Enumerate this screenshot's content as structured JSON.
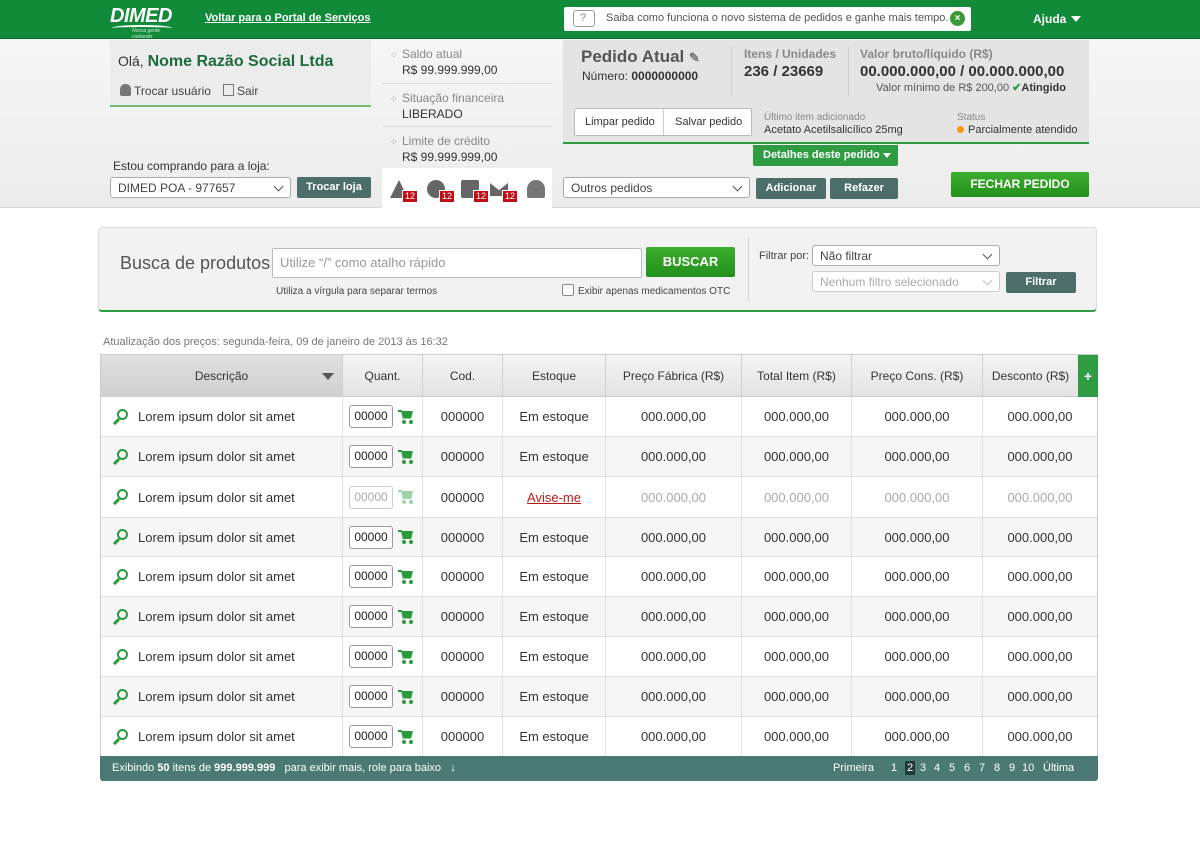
{
  "top": {
    "logo_text": "DIMED",
    "logo_tagline": "Nossa gente cuidando",
    "portal_link": "Voltar para o Portal de Serviços",
    "notice_text": "Saiba como funciona o novo sistema de pedidos e ganhe mais tempo.",
    "help_label": "Ajuda"
  },
  "user": {
    "greeting": "Olá,",
    "company_name": "Nome Razão Social Ltda",
    "switch_user": "Trocar usuário",
    "logout": "Sair",
    "store_label": "Estou comprando para a loja:",
    "store_value": "DIMED POA - 977657",
    "switch_store": "Trocar loja"
  },
  "finance": {
    "balance_label": "Saldo atual",
    "balance_value": "R$ 99.999.999,00",
    "status_label": "Situação financeira",
    "status_value": "LIBERADO",
    "limit_label": "Limite de crédito",
    "limit_value": "R$ 99.999.999,00",
    "alerts": [
      {
        "icon": "warning-icon",
        "count": "12"
      },
      {
        "icon": "dollar-icon",
        "count": "12"
      },
      {
        "icon": "calendar-icon",
        "count": "12"
      },
      {
        "icon": "mail-icon",
        "count": "12"
      }
    ]
  },
  "order": {
    "title": "Pedido Atual",
    "number_label": "Número:",
    "number_value": "0000000000",
    "items_label": "Itens / Unidades",
    "items_value": "236 / 23669",
    "value_label": "Valor bruto/líquido (R$)",
    "value_value": "00.000.000,00 / 00.000.000,00",
    "min_label": "Valor mínimo de R$ 200,00",
    "min_status": "Atingido",
    "clear_btn": "Limpar pedido",
    "save_btn": "Salvar pedido",
    "last_item_label": "Último item adicionado",
    "last_item_value": "Acetato Acetilsalicílico 25mg",
    "status_label": "Status",
    "status_value": "Parcialmente atendido",
    "details_btn": "Detalhes deste pedido",
    "other_orders": "Outros pedidos",
    "add_btn": "Adicionar",
    "redo_btn": "Refazer",
    "close_btn": "FECHAR PEDIDO"
  },
  "search": {
    "title": "Busca de produtos",
    "placeholder": "Utilize “/” como atalho rápido",
    "button": "BUSCAR",
    "hint": "Utiliza a vírgula para separar termos",
    "otc_label": "Exibir apenas medicamentos OTC",
    "filter_label": "Filtrar por:",
    "filter_value": "Não filtrar",
    "filter2_value": "Nenhum filtro selecionado",
    "filter_btn": "Filtrar"
  },
  "table": {
    "updated": "Atualização dos preços: segunda-feira, 09 de janeiro de 2013 às 16:32",
    "headers": [
      "Descrição",
      "Quant.",
      "Cod.",
      "Estoque",
      "Preço Fábrica (R$)",
      "Total Item (R$)",
      "Preço Cons. (R$)",
      "Desconto (R$)"
    ],
    "plus": "+",
    "rows": [
      {
        "desc": "Lorem ipsum dolor sit amet",
        "qty": "00000",
        "cod": "000000",
        "stock": "Em estoque",
        "factory": "000.000,00",
        "total": "000.000,00",
        "cons": "000.000,00",
        "disc": "000.000,00"
      },
      {
        "desc": "Lorem ipsum dolor sit amet",
        "qty": "00000",
        "cod": "000000",
        "stock": "Em estoque",
        "factory": "000.000,00",
        "total": "000.000,00",
        "cons": "000.000,00",
        "disc": "000.000,00"
      },
      {
        "desc": "Lorem ipsum dolor sit amet",
        "qty": "00000",
        "cod": "000000",
        "stock": "Avise-me",
        "factory": "000.000,00",
        "total": "000.000,00",
        "cons": "000.000,00",
        "disc": "000.000,00"
      },
      {
        "desc": "Lorem ipsum dolor sit amet",
        "qty": "00000",
        "cod": "000000",
        "stock": "Em estoque",
        "factory": "000.000,00",
        "total": "000.000,00",
        "cons": "000.000,00",
        "disc": "000.000,00"
      },
      {
        "desc": "Lorem ipsum dolor sit amet",
        "qty": "00000",
        "cod": "000000",
        "stock": "Em estoque",
        "factory": "000.000,00",
        "total": "000.000,00",
        "cons": "000.000,00",
        "disc": "000.000,00"
      },
      {
        "desc": "Lorem ipsum dolor sit amet",
        "qty": "00000",
        "cod": "000000",
        "stock": "Em estoque",
        "factory": "000.000,00",
        "total": "000.000,00",
        "cons": "000.000,00",
        "disc": "000.000,00"
      },
      {
        "desc": "Lorem ipsum dolor sit amet",
        "qty": "00000",
        "cod": "000000",
        "stock": "Em estoque",
        "factory": "000.000,00",
        "total": "000.000,00",
        "cons": "000.000,00",
        "disc": "000.000,00"
      },
      {
        "desc": "Lorem ipsum dolor sit amet",
        "qty": "00000",
        "cod": "000000",
        "stock": "Em estoque",
        "factory": "000.000,00",
        "total": "000.000,00",
        "cons": "000.000,00",
        "disc": "000.000,00"
      },
      {
        "desc": "Lorem ipsum dolor sit amet",
        "qty": "00000",
        "cod": "000000",
        "stock": "Em estoque",
        "factory": "000.000,00",
        "total": "000.000,00",
        "cons": "000.000,00",
        "disc": "000.000,00"
      }
    ]
  },
  "footer": {
    "showing_pre": "Exibindo",
    "showing_count": "50",
    "showing_mid": "itens de",
    "showing_total": "999.999.999",
    "more_hint": "para exibir mais, role para baixo",
    "first": "Primeira",
    "pages": [
      "1",
      "2",
      "3",
      "4",
      "5",
      "6",
      "7",
      "8",
      "9",
      "10"
    ],
    "current_page": "2",
    "last": "Última"
  },
  "colors": {
    "brand_green": "#118a3a",
    "button_green": "#2f9b43",
    "dark_teal": "#4a7a73",
    "alert_red": "#c20e16",
    "status_orange": "#f39a13"
  }
}
